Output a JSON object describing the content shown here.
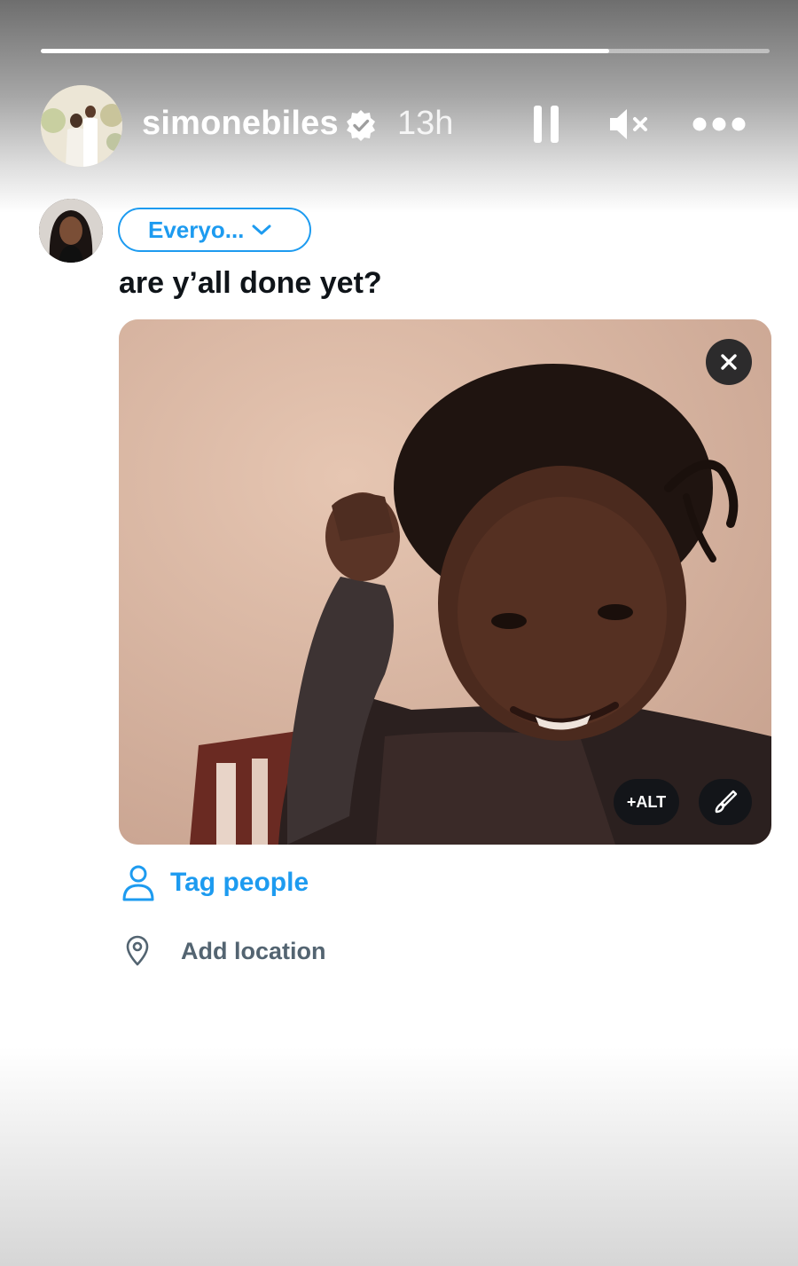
{
  "story": {
    "progress_fraction": 0.78,
    "username": "simonebiles",
    "verified_icon": "verified-badge-icon",
    "time_ago": "13h",
    "controls": {
      "pause_icon": "pause-icon",
      "mute_icon": "speaker-muted-icon",
      "more_icon": "more-options-icon"
    }
  },
  "compose": {
    "audience_label": "Everyo...",
    "text": "are y’all done yet?",
    "media": {
      "close_icon": "close-icon",
      "alt_label": "+ALT",
      "edit_icon": "brush-icon"
    },
    "tag_people_label": "Tag people",
    "add_location_label": "Add location"
  },
  "colors": {
    "accent": "#1d9bf0",
    "text": "#0f1419",
    "muted": "#536471"
  }
}
